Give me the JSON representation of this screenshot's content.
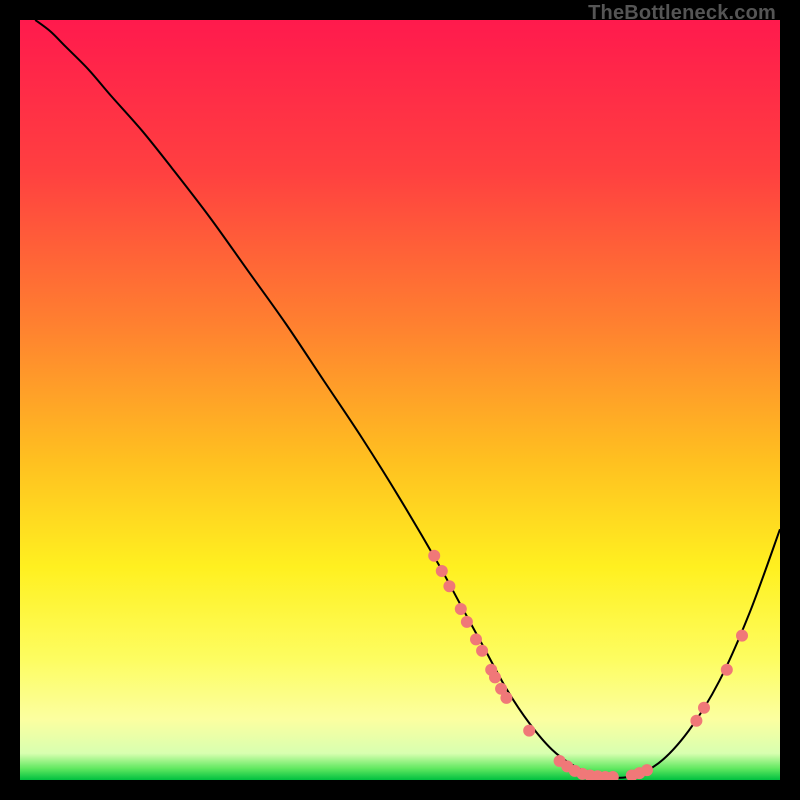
{
  "watermark": "TheBottleneck.com",
  "chart_data": {
    "type": "line",
    "title": "",
    "xlabel": "",
    "ylabel": "",
    "xlim": [
      0,
      100
    ],
    "ylim": [
      0,
      100
    ],
    "grid": false,
    "legend": false,
    "gradient_stops": [
      {
        "offset": 0.0,
        "color": "#ff1a4d"
      },
      {
        "offset": 0.2,
        "color": "#ff4040"
      },
      {
        "offset": 0.4,
        "color": "#ff8030"
      },
      {
        "offset": 0.58,
        "color": "#ffc020"
      },
      {
        "offset": 0.72,
        "color": "#fff020"
      },
      {
        "offset": 0.84,
        "color": "#fdfd60"
      },
      {
        "offset": 0.92,
        "color": "#fcffa0"
      },
      {
        "offset": 0.965,
        "color": "#d8ffb0"
      },
      {
        "offset": 0.985,
        "color": "#60e860"
      },
      {
        "offset": 1.0,
        "color": "#00c040"
      }
    ],
    "series": [
      {
        "name": "curve",
        "color": "#000000",
        "stroke_width": 2,
        "x": [
          2,
          4,
          6,
          9,
          12,
          16,
          20,
          25,
          30,
          35,
          40,
          45,
          50,
          55,
          58,
          61,
          64,
          67,
          70,
          73,
          76,
          80,
          84,
          88,
          92,
          96,
          100
        ],
        "y": [
          100,
          98.5,
          96.5,
          93.5,
          90,
          85.5,
          80.5,
          74,
          67,
          60,
          52.5,
          45,
          37,
          28.5,
          23,
          17.5,
          12,
          7.5,
          4,
          1.8,
          0.6,
          0.4,
          2.2,
          6.5,
          13,
          22,
          33
        ]
      }
    ],
    "markers": {
      "color": "#f07878",
      "radius": 6,
      "points": [
        {
          "x": 54.5,
          "y": 29.5
        },
        {
          "x": 55.5,
          "y": 27.5
        },
        {
          "x": 56.5,
          "y": 25.5
        },
        {
          "x": 58.0,
          "y": 22.5
        },
        {
          "x": 58.8,
          "y": 20.8
        },
        {
          "x": 60.0,
          "y": 18.5
        },
        {
          "x": 60.8,
          "y": 17.0
        },
        {
          "x": 62.0,
          "y": 14.5
        },
        {
          "x": 62.5,
          "y": 13.5
        },
        {
          "x": 63.3,
          "y": 12.0
        },
        {
          "x": 64.0,
          "y": 10.8
        },
        {
          "x": 67.0,
          "y": 6.5
        },
        {
          "x": 71.0,
          "y": 2.5
        },
        {
          "x": 72.0,
          "y": 1.8
        },
        {
          "x": 73.0,
          "y": 1.2
        },
        {
          "x": 74.0,
          "y": 0.8
        },
        {
          "x": 75.0,
          "y": 0.6
        },
        {
          "x": 76.0,
          "y": 0.5
        },
        {
          "x": 77.0,
          "y": 0.4
        },
        {
          "x": 78.0,
          "y": 0.4
        },
        {
          "x": 80.5,
          "y": 0.6
        },
        {
          "x": 81.5,
          "y": 0.9
        },
        {
          "x": 82.5,
          "y": 1.3
        },
        {
          "x": 89.0,
          "y": 7.8
        },
        {
          "x": 90.0,
          "y": 9.5
        },
        {
          "x": 93.0,
          "y": 14.5
        },
        {
          "x": 95.0,
          "y": 19.0
        }
      ]
    }
  }
}
